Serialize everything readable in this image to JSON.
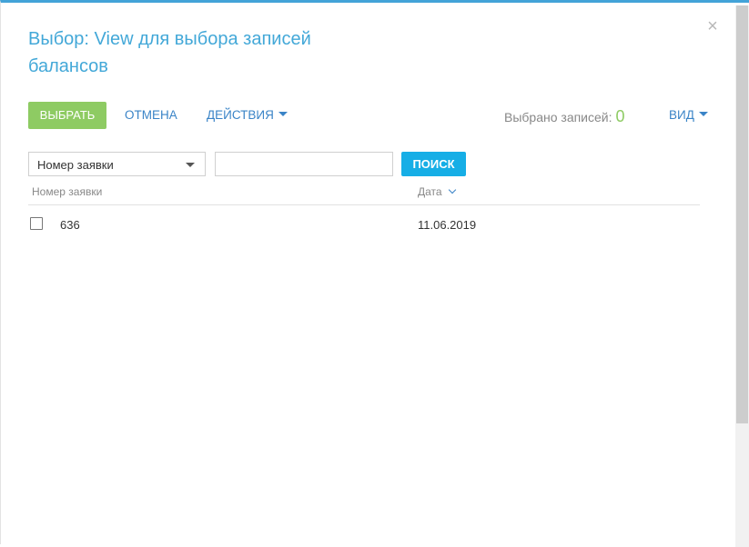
{
  "dialog": {
    "title": "Выбор: View для выбора записей балансов",
    "close_icon": "close-icon"
  },
  "toolbar": {
    "select_label": "ВЫБРАТЬ",
    "cancel_label": "ОТМЕНА",
    "actions_label": "ДЕЙСТВИЯ",
    "selected_label": "Выбрано записей:",
    "selected_count": "0",
    "view_label": "ВИД"
  },
  "filter": {
    "column_value": "Номер заявки",
    "search_value": "",
    "search_placeholder": "",
    "search_button": "ПОИСК"
  },
  "grid": {
    "columns": [
      "Номер заявки",
      "Дата"
    ],
    "rows": [
      {
        "number": "636",
        "date": "11.06.2019",
        "checked": false
      }
    ]
  },
  "colors": {
    "title": "#43a8d8",
    "select_button": "#8ecb63",
    "search_button": "#16aee6",
    "link": "#3a84c7",
    "count": "#8ecb63"
  }
}
